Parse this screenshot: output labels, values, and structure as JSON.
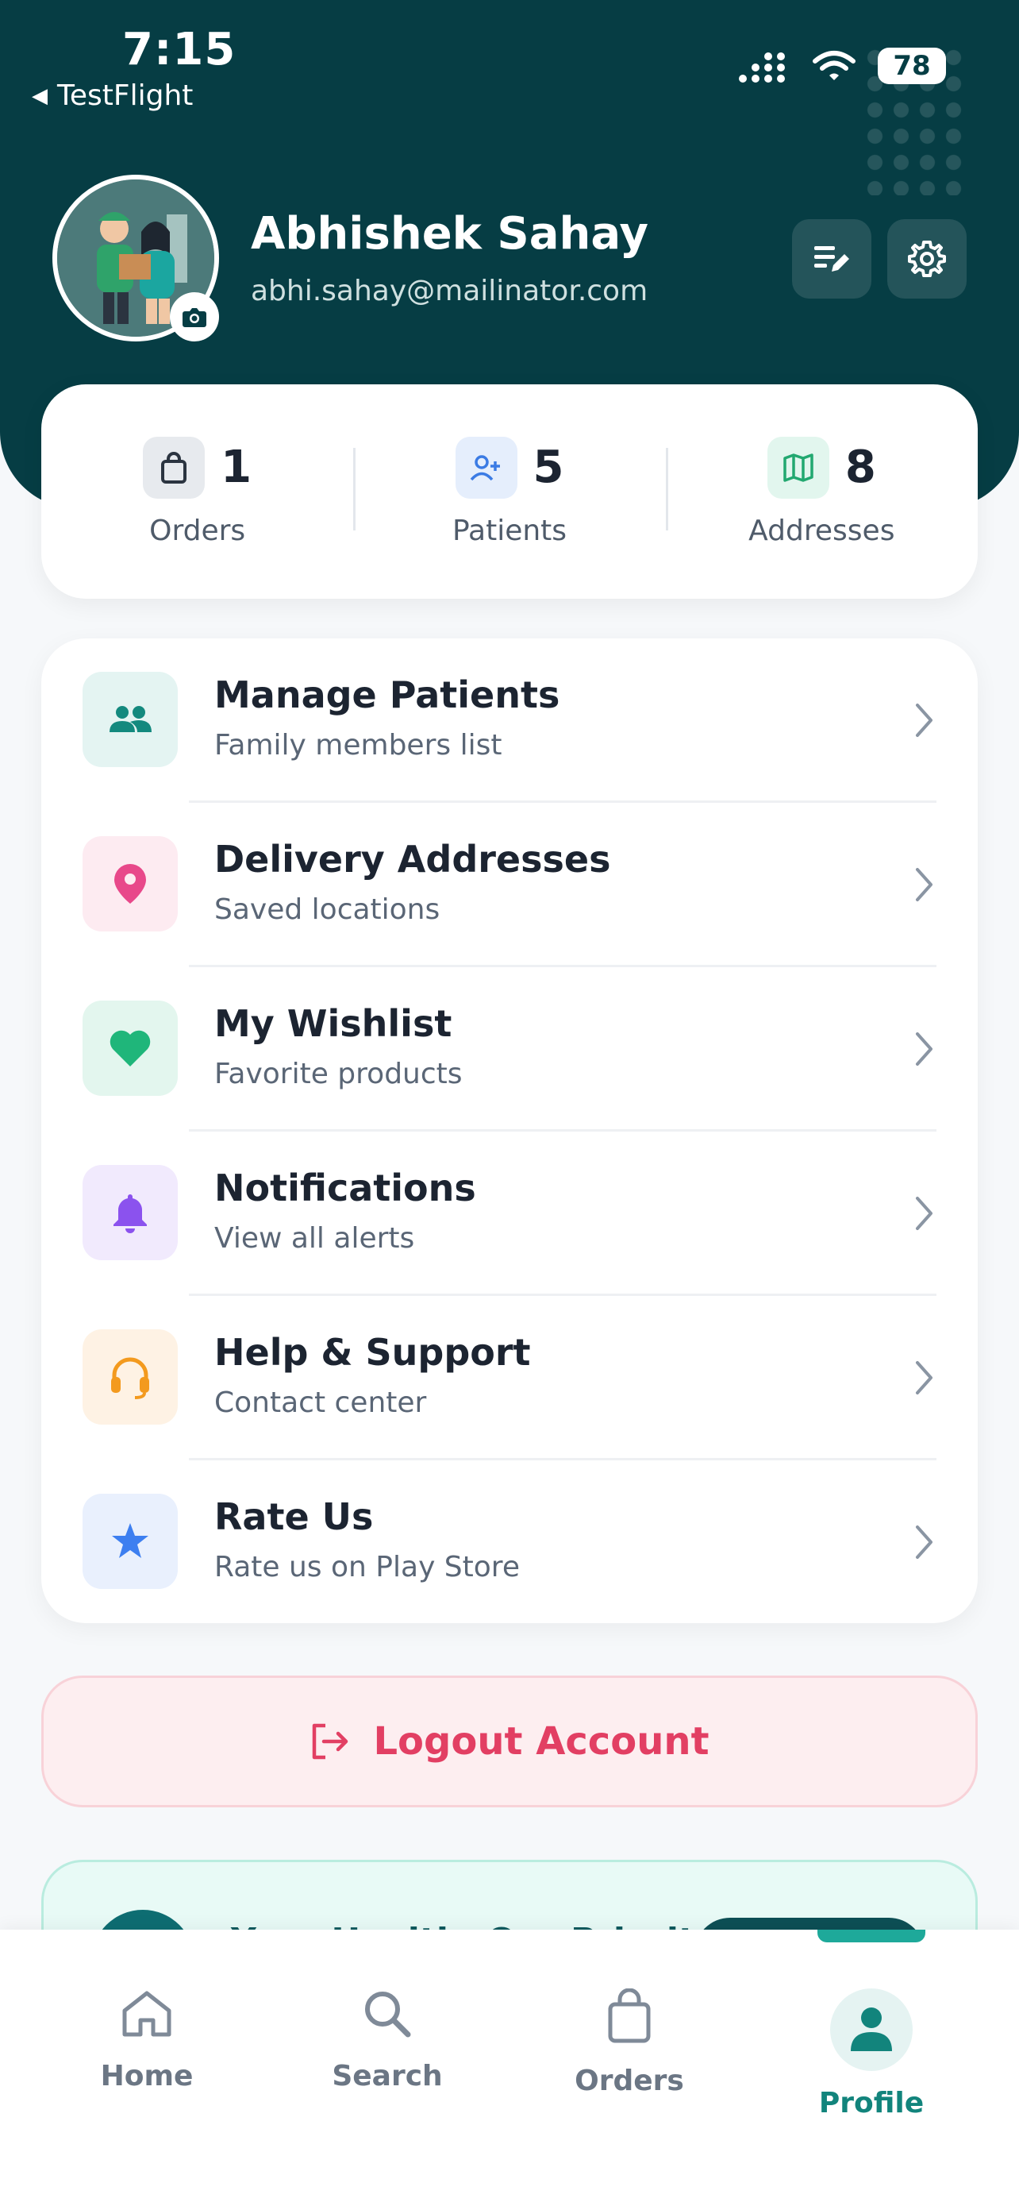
{
  "status_bar": {
    "time": "7:15",
    "back_app": "TestFlight",
    "battery": "78"
  },
  "profile": {
    "name": "Abhishek Sahay",
    "email": "abhi.sahay@mailinator.com"
  },
  "stats": [
    {
      "value": "1",
      "label": "Orders",
      "icon": "shopping-bag-icon",
      "color": "#e7eaee"
    },
    {
      "value": "5",
      "label": "Patients",
      "icon": "user-plus-icon",
      "color": "#e5eefc"
    },
    {
      "value": "8",
      "label": "Addresses",
      "icon": "map-icon",
      "color": "#e2f6ee"
    }
  ],
  "menu": [
    {
      "title": "Manage Patients",
      "subtitle": "Family members list",
      "icon": "people-icon"
    },
    {
      "title": "Delivery Addresses",
      "subtitle": "Saved locations",
      "icon": "location-pin-icon"
    },
    {
      "title": "My Wishlist",
      "subtitle": "Favorite products",
      "icon": "heart-icon"
    },
    {
      "title": "Notifications",
      "subtitle": "View all alerts",
      "icon": "bell-icon"
    },
    {
      "title": "Help & Support",
      "subtitle": "Contact center",
      "icon": "headset-icon"
    },
    {
      "title": "Rate Us",
      "subtitle": "Rate us on Play Store",
      "icon": "star-icon"
    }
  ],
  "logout_label": "Logout Account",
  "promo_text": "Your Health, Our Priority",
  "nav": [
    {
      "label": "Home",
      "icon": "home-icon"
    },
    {
      "label": "Search",
      "icon": "search-icon"
    },
    {
      "label": "Orders",
      "icon": "shopping-bag-icon"
    },
    {
      "label": "Profile",
      "icon": "person-icon"
    }
  ],
  "colors": {
    "header": "#063d44",
    "accent": "#12847c",
    "logout": "#e23f63"
  }
}
